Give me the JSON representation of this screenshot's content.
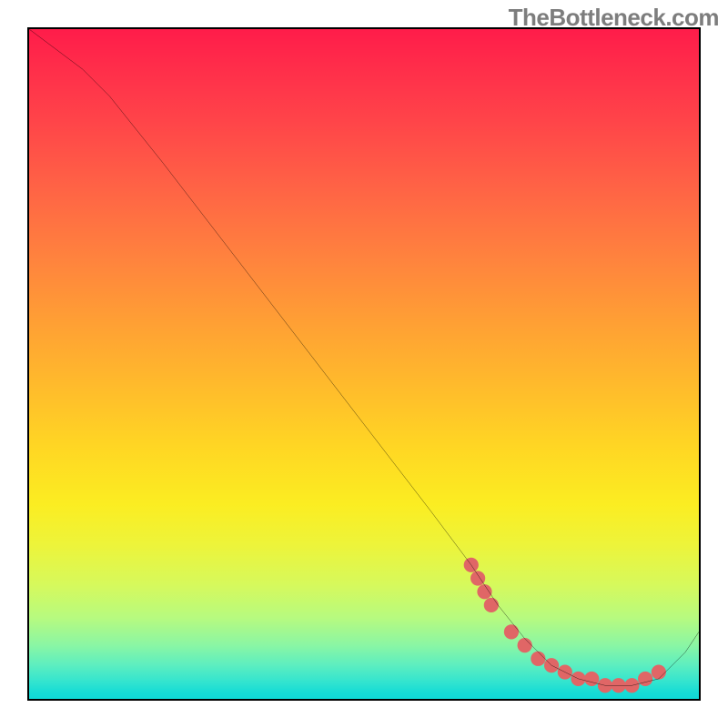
{
  "watermark": "TheBottleneck.com",
  "chart_data": {
    "type": "line",
    "title": "",
    "xlabel": "",
    "ylabel": "",
    "xlim": [
      0,
      100
    ],
    "ylim": [
      0,
      100
    ],
    "grid": false,
    "legend": null,
    "gradient_stops": [
      {
        "pos": 0,
        "color": "#ff1c4a"
      },
      {
        "pos": 24,
        "color": "#ff6445"
      },
      {
        "pos": 54,
        "color": "#ffbd2b"
      },
      {
        "pos": 77,
        "color": "#edf43a"
      },
      {
        "pos": 92,
        "color": "#8af6a4"
      },
      {
        "pos": 100,
        "color": "#0fd9d6"
      }
    ],
    "series": [
      {
        "name": "bottleneck-curve",
        "x": [
          0,
          4,
          8,
          12,
          20,
          30,
          40,
          50,
          60,
          66,
          70,
          74,
          78,
          82,
          86,
          90,
          94,
          98,
          100
        ],
        "y": [
          100,
          97,
          94,
          90,
          80,
          67,
          54,
          41,
          28,
          20,
          14,
          9,
          5,
          3,
          2,
          2,
          3,
          7,
          10
        ]
      }
    ],
    "markers": {
      "name": "highlighted-points",
      "color": "#e06666",
      "radius_px": 8,
      "points_xy": [
        [
          66,
          20
        ],
        [
          67,
          18
        ],
        [
          68,
          16
        ],
        [
          69,
          14
        ],
        [
          72,
          10
        ],
        [
          74,
          8
        ],
        [
          76,
          6
        ],
        [
          78,
          5
        ],
        [
          80,
          4
        ],
        [
          82,
          3
        ],
        [
          84,
          3
        ],
        [
          86,
          2
        ],
        [
          88,
          2
        ],
        [
          90,
          2
        ],
        [
          92,
          3
        ],
        [
          94,
          4
        ]
      ]
    }
  }
}
